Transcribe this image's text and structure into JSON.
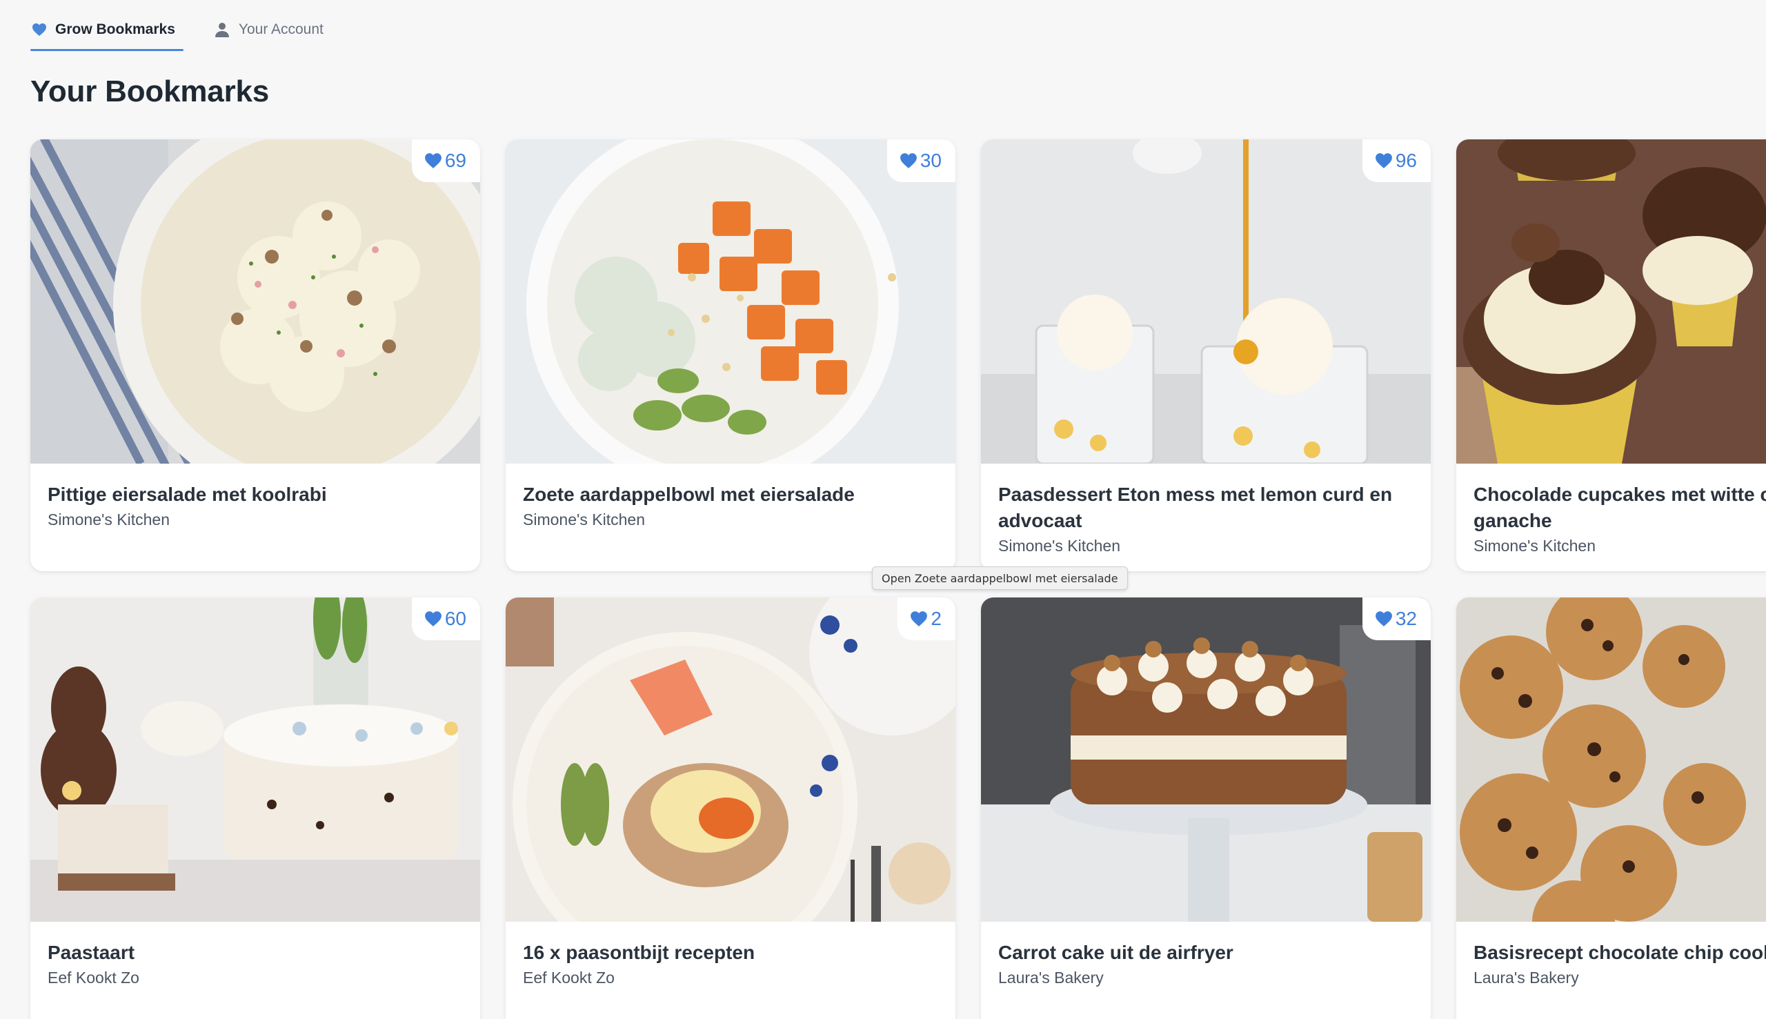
{
  "tabs": [
    {
      "label": "Grow Bookmarks",
      "icon": "heart-icon",
      "active": true
    },
    {
      "label": "Your Account",
      "icon": "user-icon",
      "active": false
    }
  ],
  "page_title": "Your Bookmarks",
  "colors": {
    "accent": "#4a86d8",
    "like": "#3f7fd9"
  },
  "cards": [
    {
      "title": "Pittige eiersalade met koolrabi",
      "author": "Simone's Kitchen",
      "likes": "69"
    },
    {
      "title": "Zoete aardappelbowl met eiersalade",
      "author": "Simone's Kitchen",
      "likes": "30"
    },
    {
      "title": "Paasdessert Eton mess met lemon curd en advocaat",
      "author": "Simone's Kitchen",
      "likes": "96"
    },
    {
      "title": "Chocolade cupcakes met witte chocolade ganache",
      "author": "Simone's Kitchen",
      "likes": ""
    },
    {
      "title": "Paastaart",
      "author": "Eef Kookt Zo",
      "likes": "60"
    },
    {
      "title": "16 x paasontbijt recepten",
      "author": "Eef Kookt Zo",
      "likes": "2"
    },
    {
      "title": "Carrot cake uit de airfryer",
      "author": "Laura's Bakery",
      "likes": "32"
    },
    {
      "title": "Basisrecept chocolate chip cookies",
      "author": "Laura's Bakery",
      "likes": ""
    }
  ],
  "tooltip": "Open Zoete aardappelbowl met eiersalade"
}
